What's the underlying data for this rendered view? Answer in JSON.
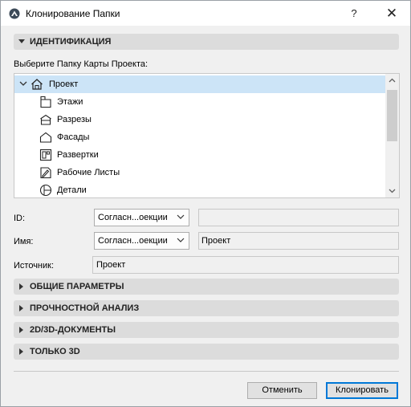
{
  "window": {
    "title": "Клонирование Папки",
    "help_label": "?",
    "close_label": "✕"
  },
  "identification": {
    "header": "ИДЕНТИФИКАЦИЯ",
    "expanded": true,
    "prompt": "Выберите Папку Карты Проекта:",
    "tree": [
      {
        "label": "Проект",
        "icon": "project-house-icon",
        "level": 0,
        "selected": true,
        "expanded": true
      },
      {
        "label": "Этажи",
        "icon": "stories-icon",
        "level": 1,
        "selected": false
      },
      {
        "label": "Разрезы",
        "icon": "sections-icon",
        "level": 1,
        "selected": false
      },
      {
        "label": "Фасады",
        "icon": "elevations-icon",
        "level": 1,
        "selected": false
      },
      {
        "label": "Развертки",
        "icon": "interior-elevations-icon",
        "level": 1,
        "selected": false
      },
      {
        "label": "Рабочие Листы",
        "icon": "worksheets-icon",
        "level": 1,
        "selected": false
      },
      {
        "label": "Детали",
        "icon": "details-icon",
        "level": 1,
        "selected": false
      }
    ],
    "id_label": "ID:",
    "id_combo_value": "Согласн...оекции",
    "id_value": "",
    "name_label": "Имя:",
    "name_combo_value": "Согласн...оекции",
    "name_value": "Проект",
    "source_label": "Источник:",
    "source_value": "Проект"
  },
  "sections": [
    {
      "header": "ОБЩИЕ ПАРАМЕТРЫ",
      "expanded": false
    },
    {
      "header": "ПРОЧНОСТНОЙ АНАЛИЗ",
      "expanded": false
    },
    {
      "header": "2D/3D-ДОКУМЕНТЫ",
      "expanded": false
    },
    {
      "header": "ТОЛЬКО 3D",
      "expanded": false
    }
  ],
  "buttons": {
    "cancel": "Отменить",
    "clone": "Клонировать"
  },
  "colors": {
    "selection": "#cce4f7",
    "section_bg": "#dcdcdc",
    "primary_border": "#0078d7"
  }
}
